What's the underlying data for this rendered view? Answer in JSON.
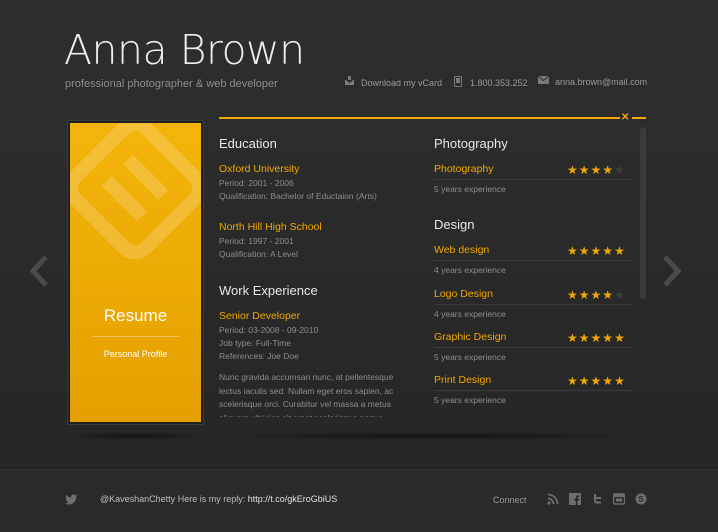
{
  "header": {
    "name": "Anna Brown",
    "subtitle": "professional photographer & web developer",
    "contacts": [
      {
        "icon": "vcard-icon",
        "label": "Download my vCard"
      },
      {
        "icon": "phone-icon",
        "label": "1.800.353.252"
      },
      {
        "icon": "mail-icon",
        "label": "anna.brown@mail.com"
      }
    ]
  },
  "card": {
    "title": "Resume",
    "subtitle": "Personal Profile"
  },
  "education": {
    "heading": "Education",
    "items": [
      {
        "title": "Oxford University",
        "period": "Period: 2001 - 2006",
        "detail": "Qualification: Bachelor of Eductaion (Arts)"
      },
      {
        "title": "North Hill High School",
        "period": "Period: 1997 - 2001",
        "detail": "Qualification: A Level"
      }
    ]
  },
  "work": {
    "heading": "Work Experience",
    "title": "Senior Developer",
    "period": "Period: 03-2008 - 09-2010",
    "jobtype": "Job type: Full-Time",
    "references": "References: Joe Doe",
    "description": "Nunc gravida accumsan nunc, at pellentesque lectus iaculis sed. Nullam eget eros sapien, ac scelerisque orci. Curabitur vel massa a metus aliquam ultricies sit amet scelerisque neque."
  },
  "skills": {
    "photography_heading": "Photography",
    "design_heading": "Design",
    "items": [
      {
        "name": "Photography",
        "rating": 4,
        "experience": "5 years experience"
      },
      {
        "name": "Web design",
        "rating": 5,
        "experience": "4 years experience"
      },
      {
        "name": "Logo Design",
        "rating": 4,
        "experience": "4 years experience"
      },
      {
        "name": "Graphic Design",
        "rating": 5,
        "experience": "5 years experience"
      },
      {
        "name": "Print Design",
        "rating": 5,
        "experience": "5 years experience"
      }
    ]
  },
  "footer": {
    "tweet_user": "@KaveshanChetty",
    "tweet_text": " Here is my reply: ",
    "tweet_link": "http://t.co/gkEroGbiUS",
    "connect_label": "Connect",
    "social": [
      "rss-icon",
      "facebook-icon",
      "twitter-icon",
      "youtube-icon",
      "skype-icon"
    ]
  },
  "colors": {
    "accent": "#f0a800",
    "background": "#2a2a2a"
  }
}
